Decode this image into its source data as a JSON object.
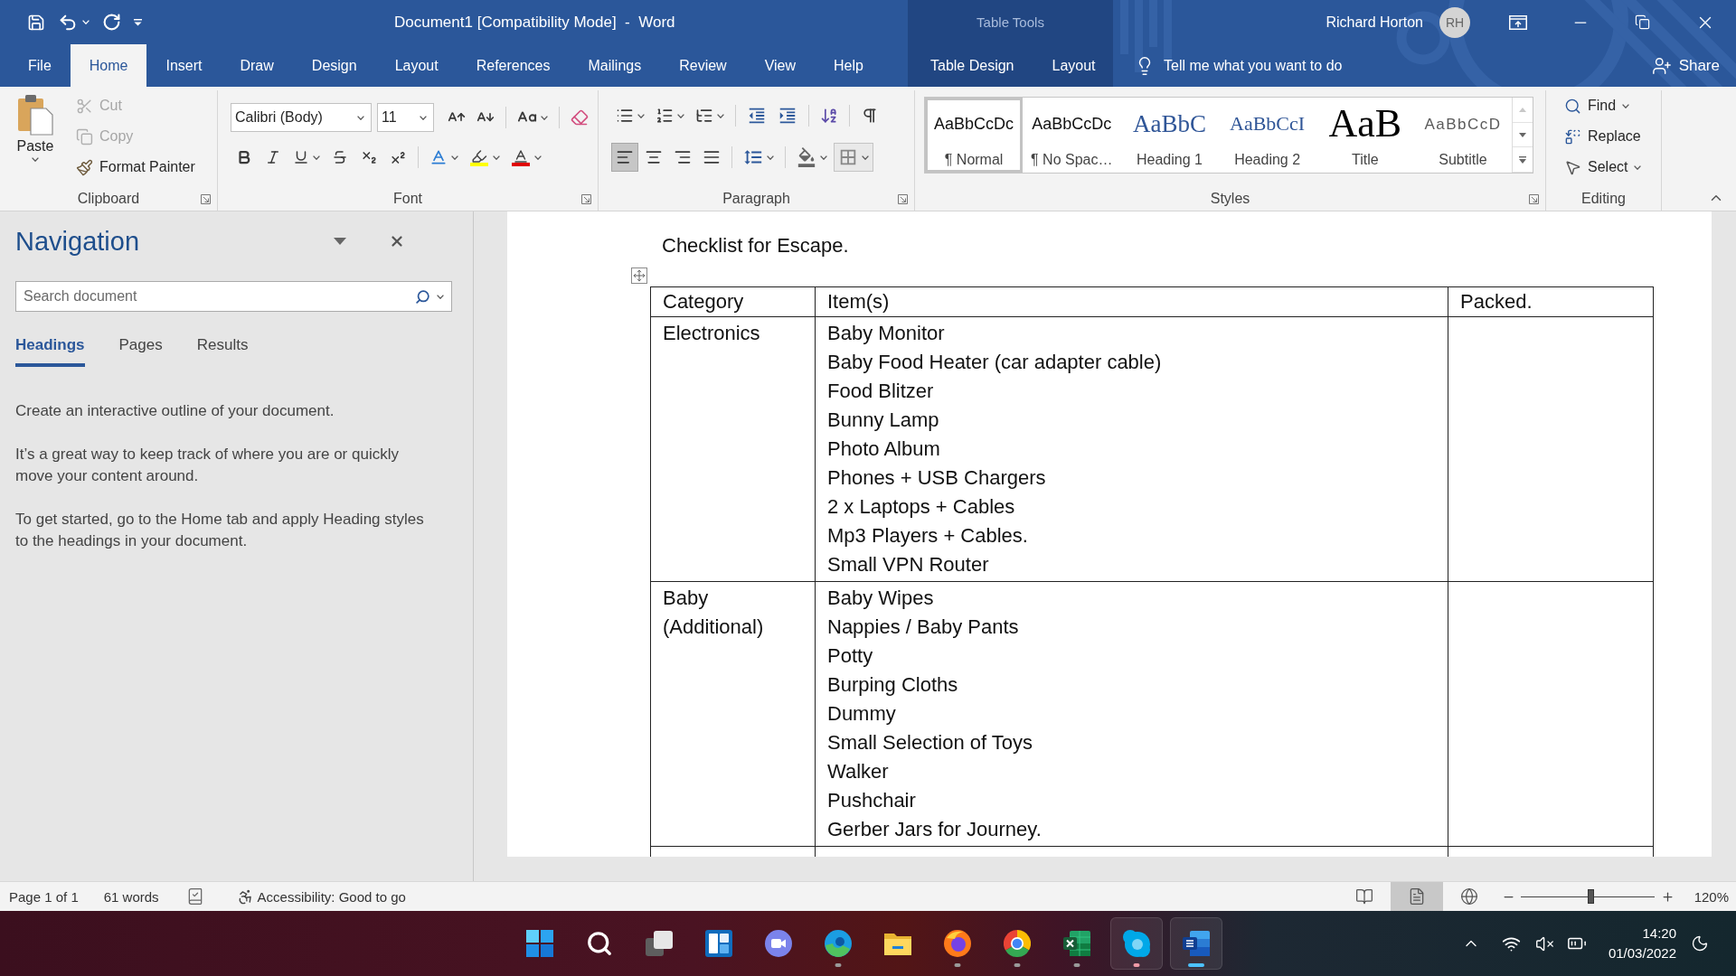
{
  "window": {
    "title": "Document1 [Compatibility Mode]  -  Word",
    "contextual_label": "Table Tools",
    "user_name": "Richard Horton",
    "user_initials": "RH"
  },
  "tabs": [
    {
      "label": "File",
      "selected": false
    },
    {
      "label": "Home",
      "selected": true
    },
    {
      "label": "Insert",
      "selected": false
    },
    {
      "label": "Draw",
      "selected": false
    },
    {
      "label": "Design",
      "selected": false
    },
    {
      "label": "Layout",
      "selected": false
    },
    {
      "label": "References",
      "selected": false
    },
    {
      "label": "Mailings",
      "selected": false
    },
    {
      "label": "Review",
      "selected": false
    },
    {
      "label": "View",
      "selected": false
    },
    {
      "label": "Help",
      "selected": false
    }
  ],
  "contextual_tabs": [
    {
      "label": "Table Design",
      "selected": false
    },
    {
      "label": "Layout",
      "selected": false
    }
  ],
  "tell_me": {
    "placeholder": "Tell me what you want to do"
  },
  "share": {
    "label": "Share"
  },
  "ribbon": {
    "clipboard": {
      "label": "Clipboard",
      "paste": "Paste",
      "commands": [
        {
          "kind": "cut",
          "label": "Cut",
          "disabled": true
        },
        {
          "kind": "copy",
          "label": "Copy",
          "disabled": true
        },
        {
          "kind": "format_painter",
          "label": "Format Painter",
          "disabled": false
        }
      ]
    },
    "font": {
      "label": "Font",
      "font_name": "Calibri (Body)",
      "font_size": "11"
    },
    "paragraph": {
      "label": "Paragraph",
      "alignments": [
        {
          "kind": "left",
          "selected": true
        },
        {
          "kind": "center",
          "selected": false
        },
        {
          "kind": "right",
          "selected": false
        },
        {
          "kind": "justify",
          "selected": false
        }
      ]
    },
    "styles": {
      "label": "Styles",
      "items": [
        {
          "kind": "normal",
          "preview": "AaBbCcDc",
          "name": "¶ Normal",
          "selected": true
        },
        {
          "kind": "no_spacing",
          "preview": "AaBbCcDc",
          "name": "¶ No Spac…",
          "selected": false
        },
        {
          "kind": "heading1",
          "preview": "AaBbC",
          "name": "Heading 1",
          "selected": false
        },
        {
          "kind": "heading2",
          "preview": "AaBbCcI",
          "name": "Heading 2",
          "selected": false
        },
        {
          "kind": "title",
          "preview": "AaB",
          "name": "Title",
          "selected": false
        },
        {
          "kind": "subtitle",
          "preview": "AaBbCcD",
          "name": "Subtitle",
          "selected": false
        }
      ]
    },
    "editing": {
      "label": "Editing",
      "commands": [
        {
          "kind": "find",
          "label": "Find"
        },
        {
          "kind": "replace",
          "label": "Replace"
        },
        {
          "kind": "select",
          "label": "Select"
        }
      ]
    }
  },
  "navigation": {
    "title": "Navigation",
    "search": {
      "placeholder": "Search document"
    },
    "tabs": [
      {
        "label": "Headings",
        "selected": true
      },
      {
        "label": "Pages",
        "selected": false
      },
      {
        "label": "Results",
        "selected": false
      }
    ],
    "paragraphs": [
      "Create an interactive outline of your document.",
      "It’s a great way to keep track of where you are or quickly move your content around.",
      "To get started, go to the Home tab and apply Heading styles to the headings in your document."
    ]
  },
  "document": {
    "heading": "Checklist for Escape.",
    "table": {
      "columns": [
        "Category",
        "Item(s)",
        "Packed."
      ],
      "rows": [
        {
          "category": "Electronics",
          "items": [
            "Baby Monitor",
            "Baby Food Heater (car adapter cable)",
            "Food Blitzer",
            "Bunny Lamp",
            "Photo Album",
            "Phones + USB Chargers",
            "2 x Laptops + Cables",
            "Mp3 Players + Cables.",
            "Small VPN Router"
          ]
        },
        {
          "category": "Baby (Additional)",
          "items": [
            "Baby Wipes",
            "Nappies / Baby Pants",
            "Potty",
            "Burping Cloths",
            "Dummy",
            "Small Selection of Toys",
            "Walker",
            "Pushchair",
            "Gerber Jars for Journey."
          ]
        }
      ]
    }
  },
  "status_bar": {
    "page": "Page 1 of 1",
    "words": "61 words",
    "accessibility": "Accessibility: Good to go",
    "views": [
      {
        "kind": "read",
        "selected": false
      },
      {
        "kind": "print",
        "selected": true
      },
      {
        "kind": "web",
        "selected": false
      }
    ],
    "zoom": {
      "level": 0.52,
      "reading": "120%"
    }
  },
  "taskbar": {
    "apps": [
      {
        "kind": "start",
        "running": false,
        "selected": false,
        "attention": false
      },
      {
        "kind": "search",
        "running": false,
        "selected": false,
        "attention": false
      },
      {
        "kind": "task_view",
        "running": false,
        "selected": false,
        "attention": false
      },
      {
        "kind": "widgets",
        "running": false,
        "selected": false,
        "attention": false
      },
      {
        "kind": "chat",
        "running": false,
        "selected": false,
        "attention": false
      },
      {
        "kind": "edge",
        "running": true,
        "selected": false,
        "attention": false
      },
      {
        "kind": "explorer",
        "running": false,
        "selected": false,
        "attention": false
      },
      {
        "kind": "firefox",
        "running": true,
        "selected": false,
        "attention": false
      },
      {
        "kind": "chrome",
        "running": true,
        "selected": false,
        "attention": false
      },
      {
        "kind": "excel",
        "running": true,
        "selected": false,
        "attention": false
      },
      {
        "kind": "skype",
        "running": true,
        "selected": false,
        "attention": true
      },
      {
        "kind": "word",
        "running": true,
        "selected": true,
        "attention": false
      }
    ],
    "time": "14:20",
    "date": "01/03/2022"
  }
}
